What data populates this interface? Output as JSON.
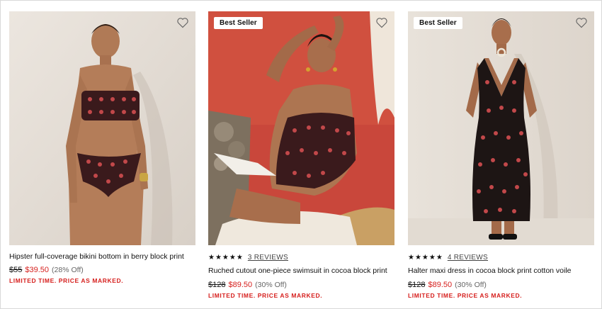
{
  "products": [
    {
      "badge": "",
      "stars": "",
      "reviews": "",
      "name": "Hipster full-coverage bikini bottom in berry block print",
      "original_price": "$55",
      "sale_price": "$39.50",
      "discount": "(28% Off)",
      "promo": "LIMITED TIME. PRICE AS MARKED."
    },
    {
      "badge": "Best Seller",
      "stars": "★★★★★",
      "reviews": "3 REVIEWS",
      "name": "Ruched cutout one-piece swimsuit in cocoa block print",
      "original_price": "$128",
      "sale_price": "$89.50",
      "discount": "(30% Off)",
      "promo": "LIMITED TIME. PRICE AS MARKED."
    },
    {
      "badge": "Best Seller",
      "stars": "★★★★★",
      "reviews": "4 REVIEWS",
      "name": "Halter maxi dress in cocoa block print cotton voile",
      "original_price": "$128",
      "sale_price": "$89.50",
      "discount": "(30% Off)",
      "promo": "LIMITED TIME. PRICE AS MARKED."
    }
  ],
  "icons": {
    "favorite": "heart-outline-icon",
    "rating": "star-icon"
  },
  "colors": {
    "sale": "#d6201e",
    "text": "#111111",
    "muted": "#666666"
  }
}
